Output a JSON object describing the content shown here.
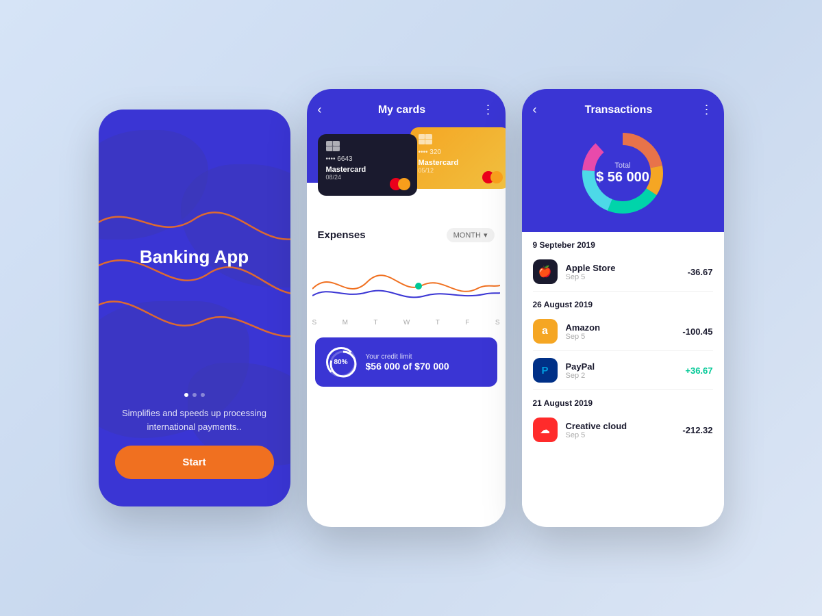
{
  "phone1": {
    "title": "Banking App",
    "subtitle": "Simplifies and speeds up processing international payments..",
    "start_btn": "Start"
  },
  "phone2": {
    "header_title": "My cards",
    "card1": {
      "number": "•••• 6643",
      "brand": "Mastercard",
      "expiry": "08/24"
    },
    "card2": {
      "number": "•••• 320",
      "brand": "Mastercard",
      "expiry": "05/12"
    },
    "expenses_title": "Expenses",
    "month_selector": "MONTH",
    "chart_labels": [
      "S",
      "M",
      "T",
      "W",
      "T",
      "F",
      "S"
    ],
    "credit": {
      "percent": "80%",
      "label": "Your credit limit",
      "amount": "$56 000 of $70 000"
    }
  },
  "phone3": {
    "header_title": "Transactions",
    "donut": {
      "label": "Total",
      "value": "$ 56 000",
      "segments": [
        {
          "color": "#e8734a",
          "pct": 22
        },
        {
          "color": "#f5a623",
          "pct": 12
        },
        {
          "color": "#00d4aa",
          "pct": 22
        },
        {
          "color": "#4dd9e8",
          "pct": 20
        },
        {
          "color": "#e84aab",
          "pct": 12
        },
        {
          "color": "#3a35d4",
          "pct": 12
        }
      ]
    },
    "groups": [
      {
        "date": "9 Septeber 2019",
        "transactions": [
          {
            "name": "Apple Store",
            "sub": "Sep 5",
            "amount": "-36.67",
            "type": "negative",
            "icon_bg": "#1a1a2e",
            "icon": "🍎"
          }
        ]
      },
      {
        "date": "26 August 2019",
        "transactions": [
          {
            "name": "Amazon",
            "sub": "Sep 5",
            "amount": "-100.45",
            "type": "negative",
            "icon_bg": "#f5a623",
            "icon": "a"
          },
          {
            "name": "PayPal",
            "sub": "Sep 2",
            "amount": "+36.67",
            "type": "positive",
            "icon_bg": "#003087",
            "icon": "P"
          }
        ]
      },
      {
        "date": "21 August  2019",
        "transactions": [
          {
            "name": "Creative cloud",
            "sub": "Sep 5",
            "amount": "-212.32",
            "type": "negative",
            "icon_bg": "#ff2b2b",
            "icon": "☁"
          }
        ]
      }
    ]
  }
}
